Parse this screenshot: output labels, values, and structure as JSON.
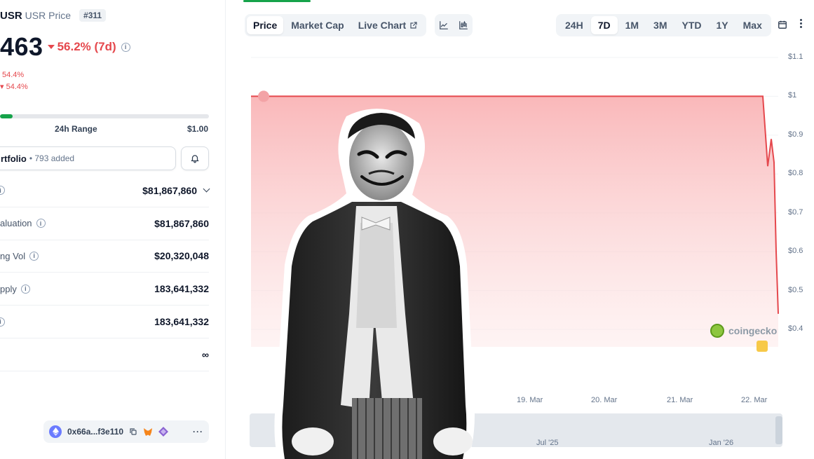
{
  "coin": {
    "symbol": "USR",
    "name_suffix": "USR Price",
    "rank": "#311",
    "price": "463",
    "change_7d": "56.2% (7d)",
    "sub_change_a": "54.4%",
    "sub_change_b": "54.4%",
    "down_color": "#e5484d"
  },
  "range": {
    "label": "24h Range",
    "high": "$1.00",
    "fill_fraction": 0.06
  },
  "portfolio": {
    "label": "rtfolio",
    "added": "• 793 added",
    "bell_icon": "bell-icon"
  },
  "stats": [
    {
      "label": "",
      "value": "$81,867,860",
      "has_chevron": true
    },
    {
      "label": "aluation",
      "value": "$81,867,860"
    },
    {
      "label": "ng Vol",
      "value": "$20,320,048"
    },
    {
      "label": "pply",
      "value": "183,641,332"
    },
    {
      "label": "",
      "value": "183,641,332"
    },
    {
      "label": "",
      "value": "∞"
    }
  ],
  "contract": {
    "address": "0x66a...f3e110",
    "copy_icon": "copy-icon",
    "metamask_icon": "metamask-icon",
    "more": "···"
  },
  "chart_tabs": {
    "price": "Price",
    "market_cap": "Market Cap",
    "live_chart": "Live Chart"
  },
  "time_ranges": [
    "24H",
    "7D",
    "1M",
    "3M",
    "YTD",
    "1Y",
    "Max"
  ],
  "active_time_range": "7D",
  "watermark": "coingecko",
  "chart_data": {
    "type": "area",
    "title": "",
    "xlabel": "",
    "ylabel": "",
    "x": [
      "19. Mar",
      "20. Mar",
      "21. Mar",
      "22. Mar"
    ],
    "x_tick_labels": [
      "19. Mar",
      "20. Mar",
      "21. Mar",
      "22. Mar"
    ],
    "y_tick_labels": [
      "$1.1",
      "$1",
      "$0.9",
      "$0.8",
      "$0.7",
      "$0.6",
      "$0.5",
      "$0.4"
    ],
    "ylim": [
      0.4,
      1.1
    ],
    "series": [
      {
        "color": "#e5484d",
        "points": [
          {
            "x": "16. Mar 00:00",
            "y": 1.0
          },
          {
            "x": "17. Mar 00:00",
            "y": 1.0
          },
          {
            "x": "18. Mar 00:00",
            "y": 1.0
          },
          {
            "x": "19. Mar 00:00",
            "y": 1.0
          },
          {
            "x": "20. Mar 00:00",
            "y": 1.0
          },
          {
            "x": "21. Mar 00:00",
            "y": 1.0
          },
          {
            "x": "22. Mar 00:00",
            "y": 1.0
          },
          {
            "x": "22. Mar 03:00",
            "y": 0.82
          },
          {
            "x": "22. Mar 04:00",
            "y": 0.89
          },
          {
            "x": "22. Mar 05:00",
            "y": 0.83
          },
          {
            "x": "22. Mar 07:00",
            "y": 0.6
          },
          {
            "x": "22. Mar 09:00",
            "y": 0.44
          }
        ]
      }
    ],
    "navigator_labels": [
      "Jul '25",
      "Jan '26"
    ],
    "grid": true,
    "fill": "gradient-red"
  }
}
